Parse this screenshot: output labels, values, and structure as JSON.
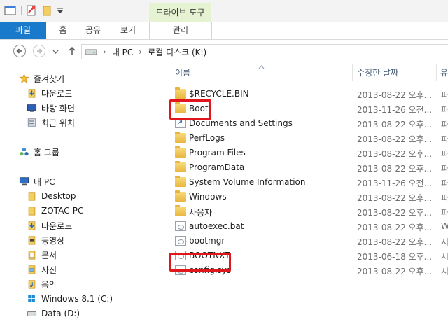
{
  "ribbon": {
    "context_group": "드라이브 도구",
    "tabs": [
      {
        "label": "파일"
      },
      {
        "label": "홈"
      },
      {
        "label": "공유"
      },
      {
        "label": "보기"
      },
      {
        "label": "관리"
      }
    ]
  },
  "address": {
    "segments": [
      "내 PC",
      "로컬 디스크 (K:)"
    ]
  },
  "nav": {
    "favorites": "즐겨찾기",
    "downloads": "다운로드",
    "desktop_fav": "바탕 화면",
    "recent": "최근 위치",
    "homegroup": "홈 그룹",
    "this_pc": "내 PC",
    "desktop": "Desktop",
    "zotac": "ZOTAC-PC",
    "downloads2": "다운로드",
    "videos": "동영상",
    "documents": "문서",
    "pictures": "사진",
    "music": "음악",
    "win_drive": "Windows 8.1 (C:)",
    "data_drive": "Data (D:)"
  },
  "columns": {
    "name": "이름",
    "modified": "수정한 날짜",
    "type": "유"
  },
  "files": [
    {
      "name": "$RECYCLE.BIN",
      "date": "2013-08-22 오후...",
      "type": "파",
      "icon": "folder-icon"
    },
    {
      "name": "Boot",
      "date": "2013-11-26 오전...",
      "type": "파",
      "icon": "folder-icon"
    },
    {
      "name": "Documents and Settings",
      "date": "2013-08-22 오후...",
      "type": "파",
      "icon": "shortcut-icon"
    },
    {
      "name": "PerfLogs",
      "date": "2013-08-22 오후...",
      "type": "파",
      "icon": "folder-icon"
    },
    {
      "name": "Program Files",
      "date": "2013-08-22 오후...",
      "type": "파",
      "icon": "folder-icon"
    },
    {
      "name": "ProgramData",
      "date": "2013-08-22 오후...",
      "type": "파",
      "icon": "folder-icon"
    },
    {
      "name": "System Volume Information",
      "date": "2013-11-26 오전...",
      "type": "파",
      "icon": "folder-icon"
    },
    {
      "name": "Windows",
      "date": "2013-08-22 오후...",
      "type": "파",
      "icon": "folder-icon"
    },
    {
      "name": "사용자",
      "date": "2013-08-22 오후...",
      "type": "파",
      "icon": "folder-icon"
    },
    {
      "name": "autoexec.bat",
      "date": "2013-08-22 오후...",
      "type": "W",
      "icon": "file-icon"
    },
    {
      "name": "bootmgr",
      "date": "2013-08-22 오후...",
      "type": "시",
      "icon": "file-icon"
    },
    {
      "name": "BOOTNXT",
      "date": "2013-06-18 오후...",
      "type": "시",
      "icon": "file-icon"
    },
    {
      "name": "config.sys",
      "date": "2013-08-22 오후...",
      "type": "시",
      "icon": "file-icon"
    }
  ]
}
